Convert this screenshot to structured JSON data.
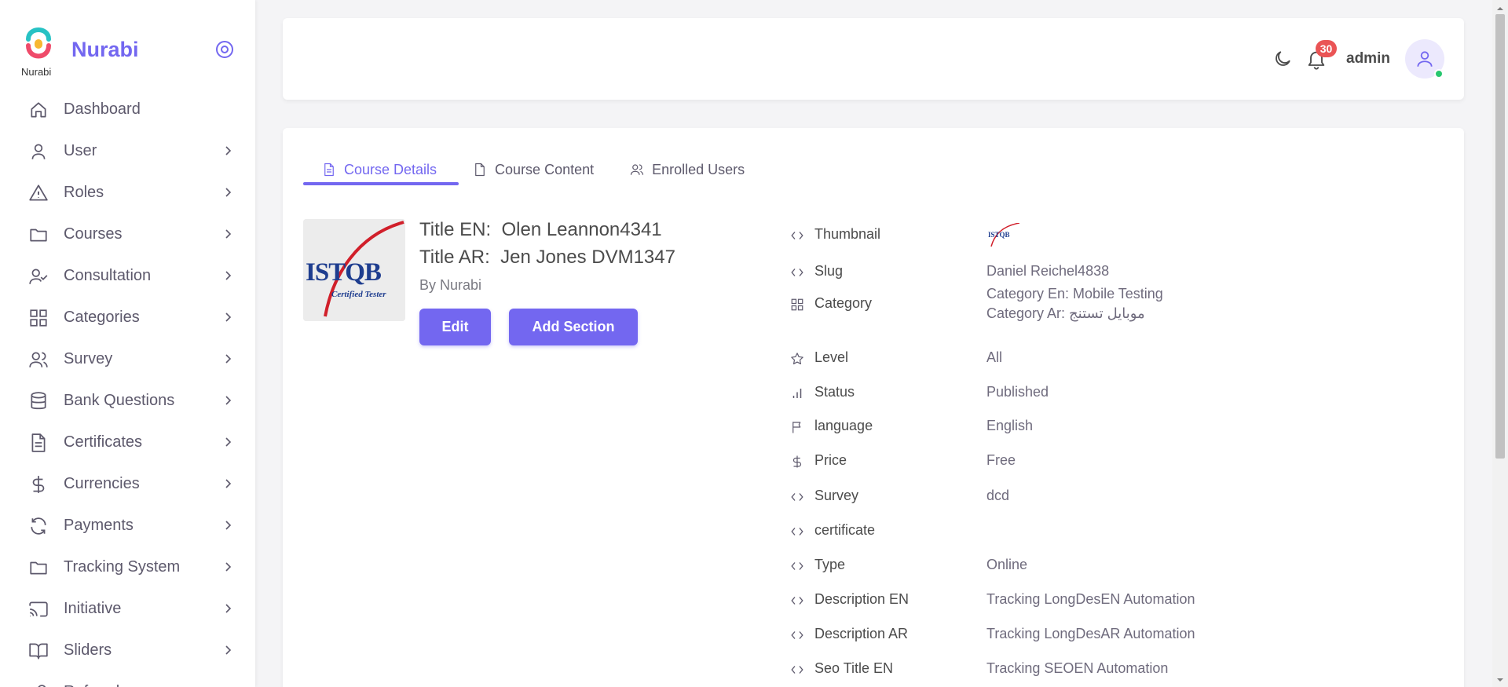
{
  "brand": {
    "name": "Nurabi",
    "logo_caption": "Nurabi"
  },
  "sidebar": {
    "items": [
      {
        "label": "Dashboard",
        "icon": "home-icon",
        "has_children": false
      },
      {
        "label": "User",
        "icon": "user-icon",
        "has_children": true
      },
      {
        "label": "Roles",
        "icon": "alert-triangle-icon",
        "has_children": true
      },
      {
        "label": "Courses",
        "icon": "folder-icon",
        "has_children": true
      },
      {
        "label": "Consultation",
        "icon": "user-check-icon",
        "has_children": true
      },
      {
        "label": "Categories",
        "icon": "grid-icon",
        "has_children": true
      },
      {
        "label": "Survey",
        "icon": "users-icon",
        "has_children": true
      },
      {
        "label": "Bank Questions",
        "icon": "database-icon",
        "has_children": true
      },
      {
        "label": "Certificates",
        "icon": "file-text-icon",
        "has_children": true
      },
      {
        "label": "Currencies",
        "icon": "dollar-icon",
        "has_children": true
      },
      {
        "label": "Payments",
        "icon": "refresh-icon",
        "has_children": true
      },
      {
        "label": "Tracking System",
        "icon": "folder-icon",
        "has_children": true
      },
      {
        "label": "Initiative",
        "icon": "cast-icon",
        "has_children": true
      },
      {
        "label": "Sliders",
        "icon": "book-open-icon",
        "has_children": true
      },
      {
        "label": "Referrals",
        "icon": "link-icon",
        "has_children": true
      }
    ]
  },
  "topbar": {
    "notifications_count": "30",
    "username": "admin"
  },
  "tabs": [
    {
      "label": "Course Details",
      "icon": "file-text-icon",
      "active": true
    },
    {
      "label": "Course Content",
      "icon": "file-icon",
      "active": false
    },
    {
      "label": "Enrolled Users",
      "icon": "users-icon",
      "active": false
    }
  ],
  "course": {
    "title_en_label": "Title EN:",
    "title_en": "Olen Leannon4341",
    "title_ar_label": "Title AR:",
    "title_ar": "Jen Jones DVM1347",
    "by": "By Nurabi",
    "image_text": "ISTQB",
    "image_subtext": "Certified Tester",
    "edit_label": "Edit",
    "add_section_label": "Add Section"
  },
  "details": [
    {
      "label": "Thumbnail",
      "icon": "code-icon",
      "value": ""
    },
    {
      "label": "Slug",
      "icon": "code-icon",
      "value": "Daniel Reichel4838"
    },
    {
      "label": "Category",
      "icon": "grid-icon",
      "value": "Category En: Mobile Testing",
      "value2": "Category Ar: موبايل تستنج"
    },
    {
      "label": "Level",
      "icon": "star-icon",
      "value": "All"
    },
    {
      "label": "Status",
      "icon": "bar-chart-icon",
      "value": "Published"
    },
    {
      "label": "language",
      "icon": "flag-icon",
      "value": "English"
    },
    {
      "label": "Price",
      "icon": "dollar-icon",
      "value": "Free"
    },
    {
      "label": "Survey",
      "icon": "code-icon",
      "value": "dcd"
    },
    {
      "label": "certificate",
      "icon": "code-icon",
      "value": ""
    },
    {
      "label": "Type",
      "icon": "code-icon",
      "value": "Online"
    },
    {
      "label": "Description EN",
      "icon": "code-icon",
      "value": "Tracking LongDesEN Automation"
    },
    {
      "label": "Description AR",
      "icon": "code-icon",
      "value": "Tracking LongDesAR Automation"
    },
    {
      "label": "Seo Title EN",
      "icon": "code-icon",
      "value": "Tracking SEOEN Automation"
    }
  ],
  "colors": {
    "primary": "#7367f0",
    "danger": "#ea5455",
    "success": "#28c76f",
    "text": "#5d596c"
  }
}
